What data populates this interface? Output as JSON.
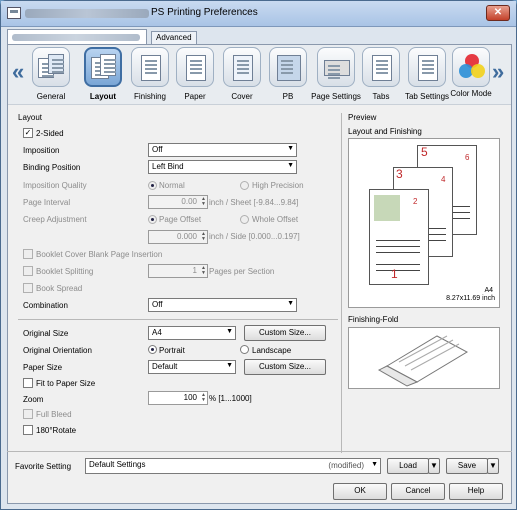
{
  "window": {
    "title": "PS Printing Preferences",
    "close": "✕"
  },
  "tabs": {
    "advanced": "Advanced"
  },
  "features": [
    {
      "label": "General"
    },
    {
      "label": "Layout"
    },
    {
      "label": "Finishing"
    },
    {
      "label": "Paper"
    },
    {
      "label": "Cover"
    },
    {
      "label": "PB"
    },
    {
      "label": "Page Settings"
    },
    {
      "label": "Tabs"
    },
    {
      "label": "Tab Settings"
    },
    {
      "label": "Color Mode"
    }
  ],
  "nav": {
    "prev": "«",
    "next": "»"
  },
  "layout": {
    "group_title": "Layout",
    "two_sided_label": "2-Sided",
    "two_sided_checked": "✓",
    "imposition_label": "Imposition",
    "imposition_value": "Off",
    "binding_label": "Binding Position",
    "binding_value": "Left Bind",
    "quality_label": "Imposition Quality",
    "quality_normal": "Normal",
    "quality_high": "High Precision",
    "interval_label": "Page Interval",
    "interval_value": "0.00",
    "interval_unit": "inch / Sheet [-9.84...9.84]",
    "creep_label": "Creep Adjustment",
    "creep_offset": "Page Offset",
    "creep_whole": "Whole Offset",
    "creep_value": "0.000",
    "creep_unit": "inch / Side [0.000...0.197]",
    "booklet_cover_label": "Booklet Cover Blank Page Insertion",
    "booklet_split_label": "Booklet Splitting",
    "booklet_split_value": "1",
    "booklet_split_unit": "Pages per Section",
    "book_spread_label": "Book Spread",
    "combination_label": "Combination",
    "combination_value": "Off"
  },
  "paper": {
    "original_size_label": "Original Size",
    "original_size_value": "A4",
    "custom_size_1": "Custom Size...",
    "orientation_label": "Original Orientation",
    "portrait": "Portrait",
    "landscape": "Landscape",
    "paper_size_label": "Paper Size",
    "paper_size_value": "Default",
    "custom_size_2": "Custom Size...",
    "fit_label": "Fit to Paper Size",
    "zoom_label": "Zoom",
    "zoom_value": "100",
    "zoom_unit": "% [1...1000]",
    "full_bleed_label": "Full Bleed",
    "rotate_label": "180°Rotate"
  },
  "preview": {
    "group_title": "Preview",
    "layout_title": "Layout and Finishing",
    "paper_name": "A4",
    "paper_dims": "8.27x11.69 inch",
    "page_numbers": [
      "1",
      "2",
      "3",
      "4",
      "5",
      "6"
    ],
    "fold_title": "Finishing-Fold"
  },
  "footer": {
    "favorite_label": "Favorite Setting",
    "favorite_value": "Default Settings",
    "modified": "(modified)",
    "load": "Load",
    "save": "Save",
    "ok": "OK",
    "cancel": "Cancel",
    "help": "Help"
  },
  "colors": {
    "accent": "#3f6ea3",
    "page_number_red": "#c0282a",
    "title_bg": "#a9c4e6"
  }
}
